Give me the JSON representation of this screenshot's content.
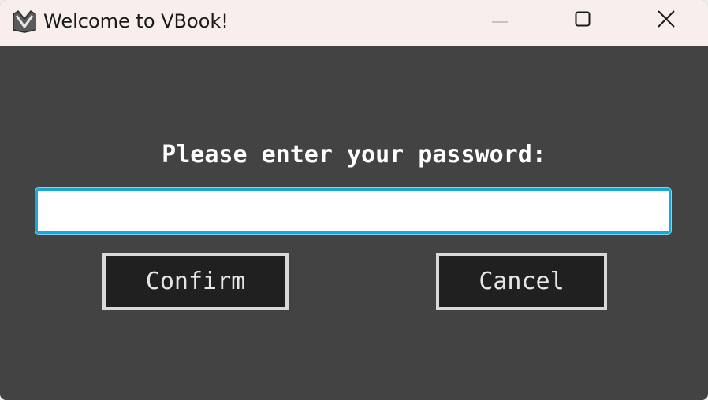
{
  "window": {
    "title": "Welcome to VBook!",
    "app_icon": "vbook-logo-icon",
    "controls": {
      "minimize": "minimize-icon",
      "maximize": "maximize-icon",
      "close": "close-icon"
    }
  },
  "dialog": {
    "prompt": "Please enter your password:",
    "password_value": "",
    "confirm_label": "Confirm",
    "cancel_label": "Cancel"
  },
  "colors": {
    "titlebar_bg": "#f8efec",
    "content_bg": "#434343",
    "input_focus_border": "#19a8d6",
    "button_bg": "#202020",
    "button_border": "#d9d9d9"
  }
}
